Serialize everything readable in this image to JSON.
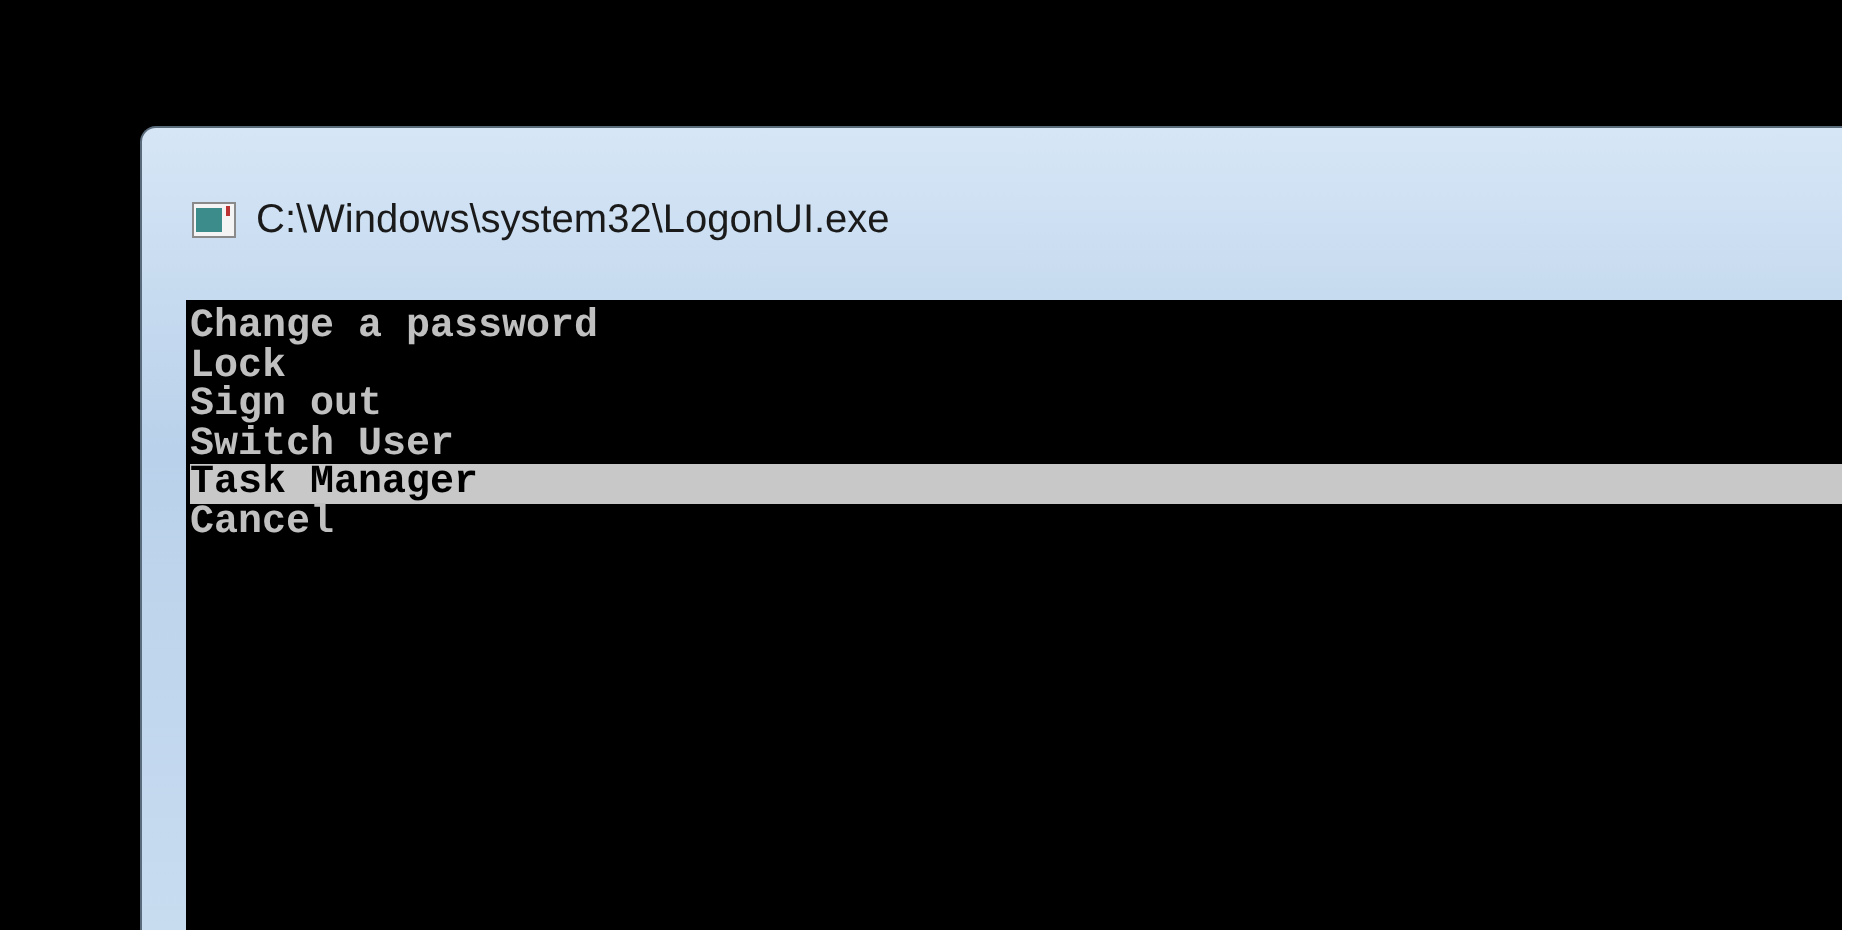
{
  "window": {
    "title": "C:\\Windows\\system32\\LogonUI.exe"
  },
  "menu": {
    "items": [
      {
        "label": "Change a password",
        "selected": false
      },
      {
        "label": "Lock",
        "selected": false
      },
      {
        "label": "Sign out",
        "selected": false
      },
      {
        "label": "Switch User",
        "selected": false
      },
      {
        "label": "Task Manager",
        "selected": true
      },
      {
        "label": "Cancel",
        "selected": false
      }
    ]
  }
}
